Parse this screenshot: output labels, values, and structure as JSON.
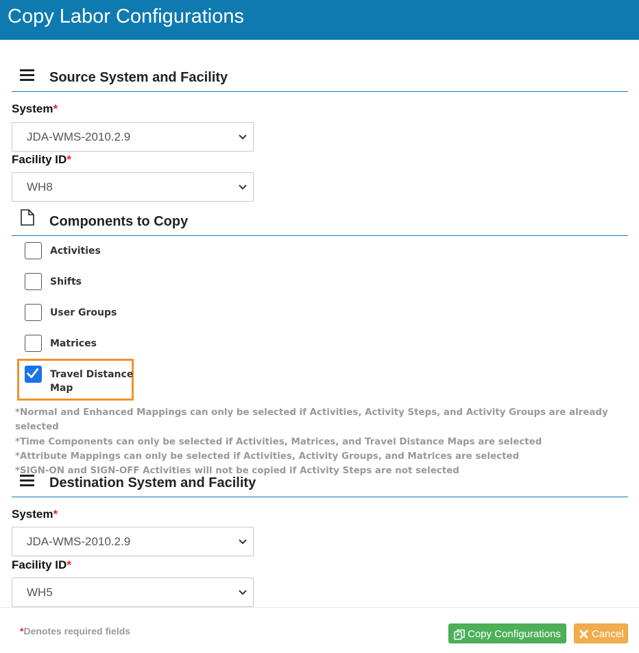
{
  "window": {
    "title": "Copy Labor Configurations"
  },
  "source": {
    "heading": "Source System and Facility",
    "heading_icon": "hamburger-menu-icon",
    "system_label": "System",
    "system_value": "JDA-WMS-2010.2.9",
    "facility_label": "Facility ID",
    "facility_value": "WH8"
  },
  "components": {
    "heading": "Components to Copy",
    "heading_icon": "document-icon",
    "items": [
      {
        "label": "Activities",
        "checked": false
      },
      {
        "label": "Shifts",
        "checked": false
      },
      {
        "label": "User Groups",
        "checked": false
      },
      {
        "label": "Matrices",
        "checked": false
      },
      {
        "label_line1": "Travel Distance",
        "label_line2": "Map",
        "checked": true
      }
    ],
    "notes": [
      "*Normal and Enhanced Mappings can only be selected if Activities, Activity Steps, and Activity Groups are already selected",
      "*Time Components can only be selected if Activities, Matrices, and Travel Distance Maps are selected",
      "*Attribute Mappings can only be selected if Activities, Activity Groups, and Matrices are selected",
      "*SIGN-ON and SIGN-OFF Activities will not be copied if Activity Steps are not selected"
    ]
  },
  "destination": {
    "heading": "Destination System and Facility",
    "heading_icon": "hamburger-menu-icon",
    "system_label": "System",
    "system_value": "JDA-WMS-2010.2.9",
    "facility_label": "Facility ID",
    "facility_value": "WH5"
  },
  "required_marker": "*",
  "footer": {
    "required_note": "Denotes required fields",
    "copy_button": "Copy Configurations",
    "cancel_button": "Cancel"
  },
  "colors": {
    "header_bg": "#0e7ab0",
    "required": "#e0252b",
    "copy_button": "#4db059",
    "cancel_button": "#f0ad4e",
    "highlight_border": "#f0932b",
    "checkbox_checked": "#1a73e8"
  }
}
